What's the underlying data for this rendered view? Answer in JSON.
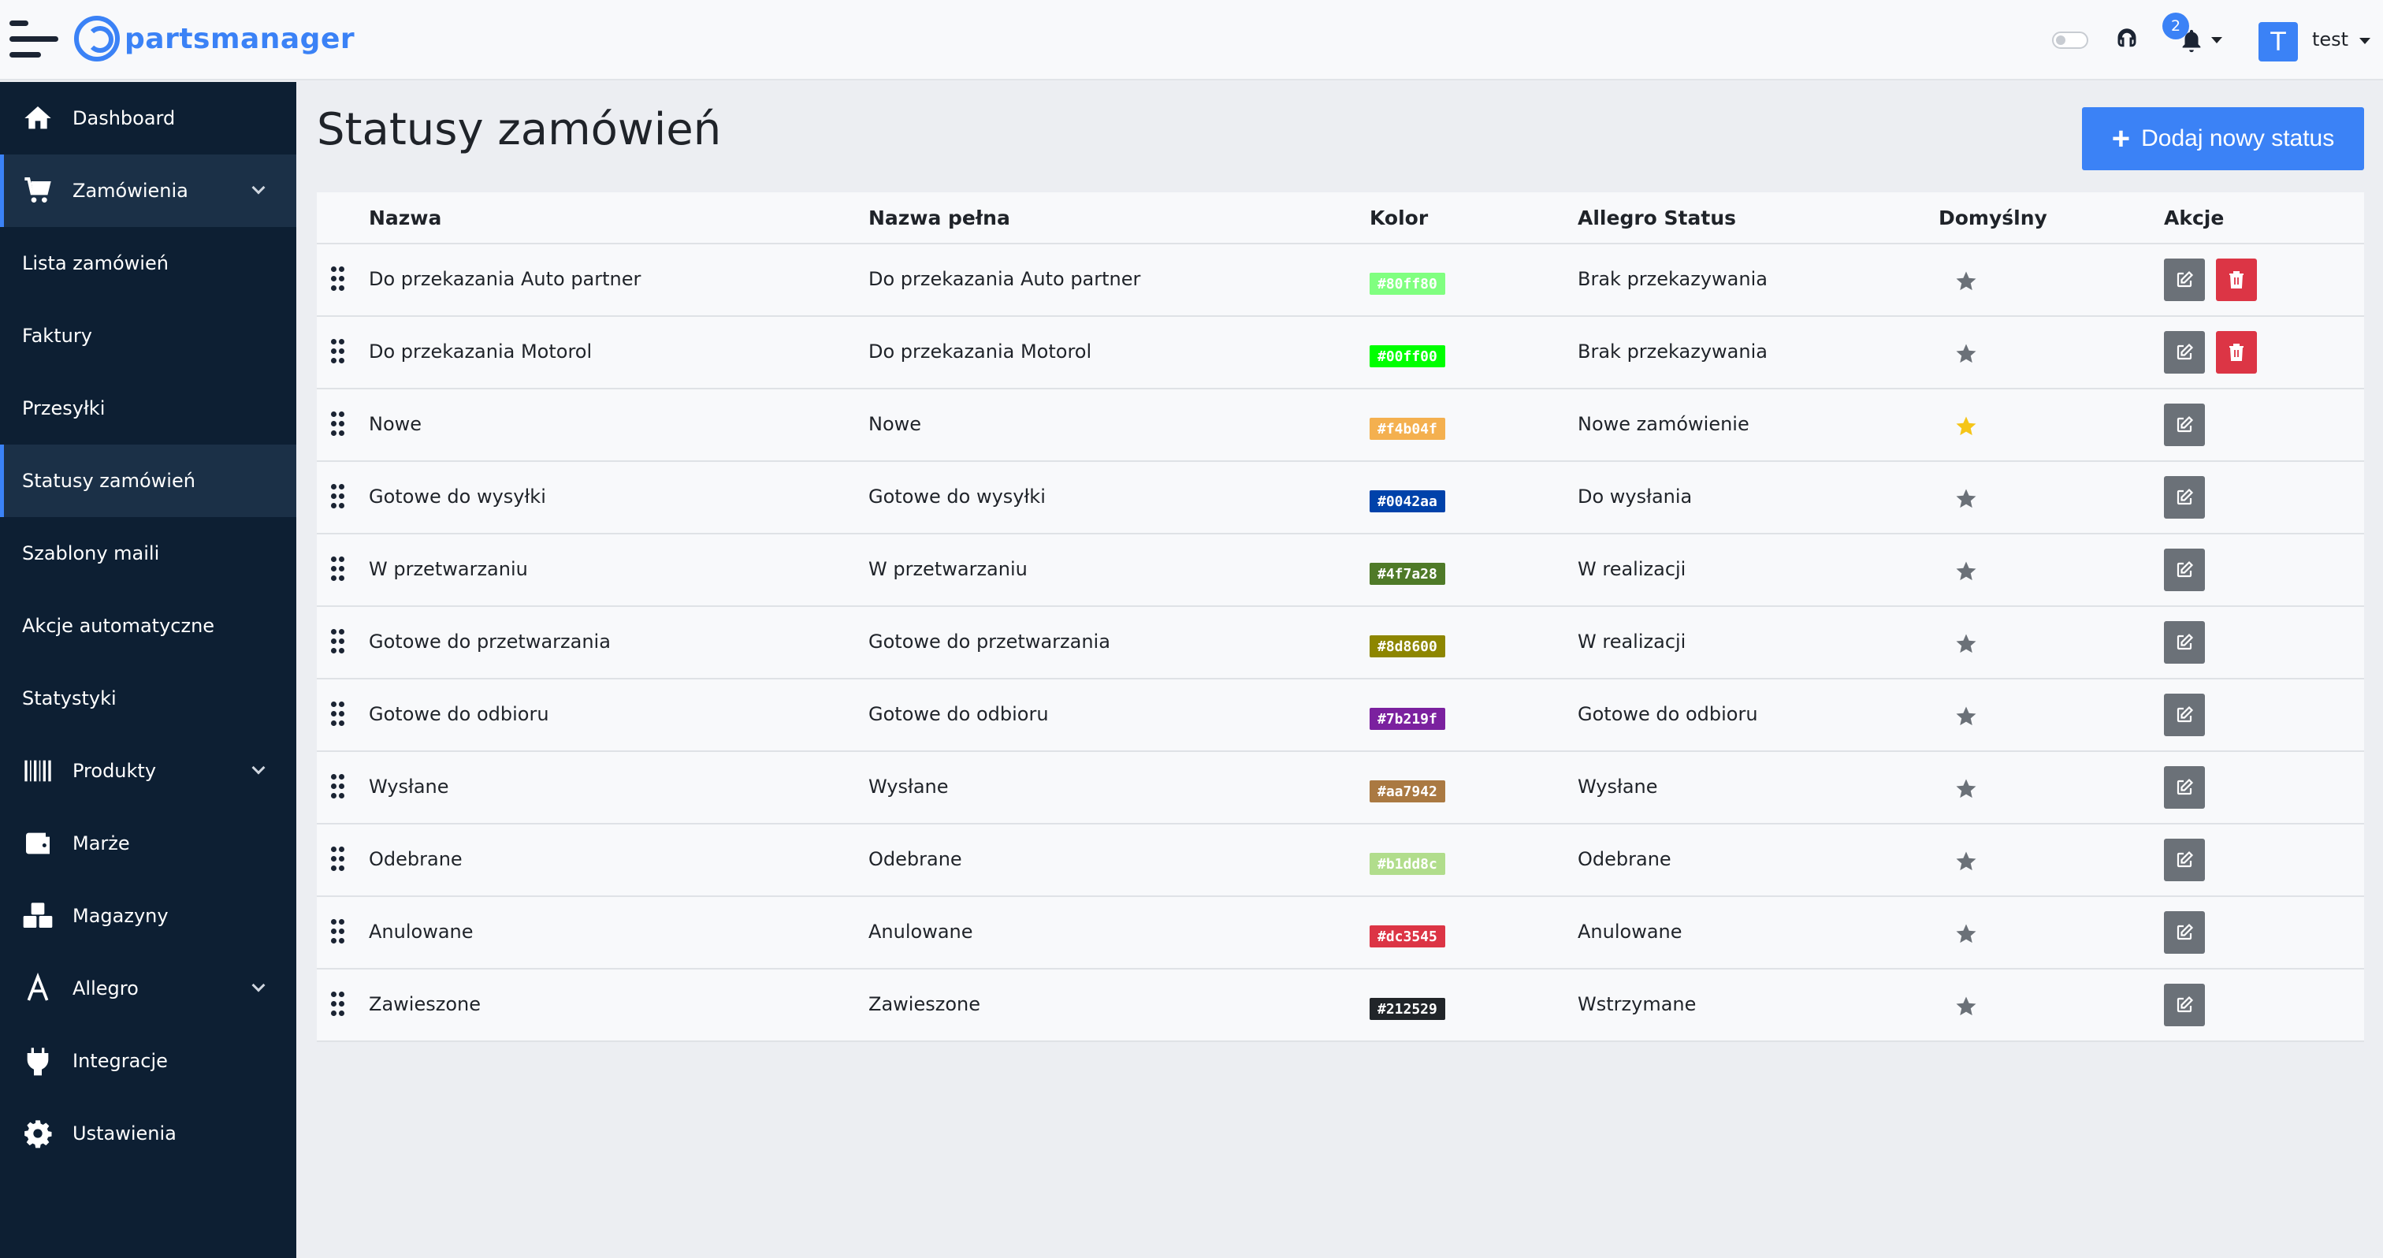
{
  "header": {
    "logo_text": "partsmanager",
    "notifications_count": "2",
    "avatar_letter": "T",
    "username": "test"
  },
  "sidebar": {
    "items": [
      {
        "label": "Dashboard",
        "icon": "home-icon"
      },
      {
        "label": "Zamówienia",
        "icon": "cart-icon",
        "expandable": true
      },
      {
        "label": "Lista zamówień"
      },
      {
        "label": "Faktury"
      },
      {
        "label": "Przesyłki"
      },
      {
        "label": "Statusy zamówień",
        "active": true
      },
      {
        "label": "Szablony maili"
      },
      {
        "label": "Akcje automatyczne"
      },
      {
        "label": "Statystyki"
      },
      {
        "label": "Produkty",
        "icon": "barcode-icon",
        "expandable": true
      },
      {
        "label": "Marże",
        "icon": "wallet-icon"
      },
      {
        "label": "Magazyny",
        "icon": "boxes-icon"
      },
      {
        "label": "Allegro",
        "icon": "allegro-icon",
        "expandable": true
      },
      {
        "label": "Integracje",
        "icon": "plug-icon"
      },
      {
        "label": "Ustawienia",
        "icon": "gear-icon"
      }
    ]
  },
  "main": {
    "title": "Statusy zamówień",
    "add_button_label": "Dodaj nowy status",
    "columns": [
      "Nazwa",
      "Nazwa pełna",
      "Kolor",
      "Allegro Status",
      "Domyślny",
      "Akcje"
    ],
    "rows": [
      {
        "name": "Do przekazania Auto partner",
        "full_name": "Do przekazania Auto partner",
        "color": "#80ff80",
        "allegro": "Brak przekazywania",
        "default": false,
        "deletable": true
      },
      {
        "name": "Do przekazania Motorol",
        "full_name": "Do przekazania Motorol",
        "color": "#00ff00",
        "allegro": "Brak przekazywania",
        "default": false,
        "deletable": true
      },
      {
        "name": "Nowe",
        "full_name": "Nowe",
        "color": "#f4b04f",
        "allegro": "Nowe zamówienie",
        "default": true,
        "deletable": false
      },
      {
        "name": "Gotowe do wysyłki",
        "full_name": "Gotowe do wysyłki",
        "color": "#0042aa",
        "allegro": "Do wysłania",
        "default": false,
        "deletable": false
      },
      {
        "name": "W przetwarzaniu",
        "full_name": "W przetwarzaniu",
        "color": "#4f7a28",
        "allegro": "W realizacji",
        "default": false,
        "deletable": false
      },
      {
        "name": "Gotowe do przetwarzania",
        "full_name": "Gotowe do przetwarzania",
        "color": "#8d8600",
        "allegro": "W realizacji",
        "default": false,
        "deletable": false
      },
      {
        "name": "Gotowe do odbioru",
        "full_name": "Gotowe do odbioru",
        "color": "#7b219f",
        "allegro": "Gotowe do odbioru",
        "default": false,
        "deletable": false
      },
      {
        "name": "Wysłane",
        "full_name": "Wysłane",
        "color": "#aa7942",
        "allegro": "Wysłane",
        "default": false,
        "deletable": false
      },
      {
        "name": "Odebrane",
        "full_name": "Odebrane",
        "color": "#b1dd8c",
        "allegro": "Odebrane",
        "default": false,
        "deletable": false
      },
      {
        "name": "Anulowane",
        "full_name": "Anulowane",
        "color": "#dc3545",
        "allegro": "Anulowane",
        "default": false,
        "deletable": false
      },
      {
        "name": "Zawieszone",
        "full_name": "Zawieszone",
        "color": "#212529",
        "allegro": "Wstrzymane",
        "default": false,
        "deletable": false
      }
    ]
  },
  "colors": {
    "accent": "#3b82f6",
    "sidebar_bg": "#0d1f33",
    "star_default": "#f5c518",
    "star_inactive": "#6b7178",
    "delete": "#dc3545"
  }
}
